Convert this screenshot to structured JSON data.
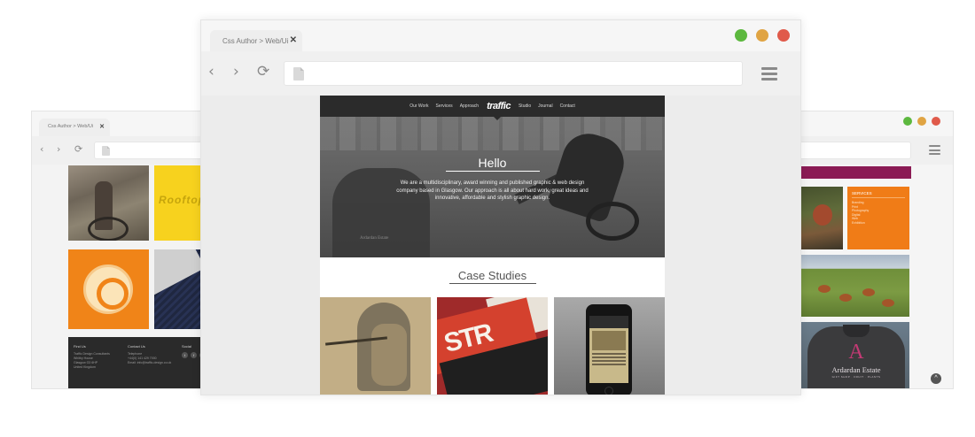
{
  "colors": {
    "dot_green": "#5cb83e",
    "dot_yellow": "#e0a443",
    "dot_red": "#e05a4a",
    "accent_orange": "#f08418",
    "accent_maroon": "#8b1b55"
  },
  "main_browser": {
    "tab_title": "Css Author > Web/Ui",
    "tab_close": "✕",
    "icons": {
      "back": "chevron-left-icon",
      "forward": "chevron-right-icon",
      "reload": "reload-icon",
      "page": "document-icon",
      "menu": "hamburger-menu-icon"
    },
    "glyphs": {
      "back": "‹",
      "forward": "›",
      "reload": "⟳"
    }
  },
  "left_browser": {
    "tab_title": "Css Author > Web/Ui",
    "tab_close": "✕",
    "glyphs": {
      "back": "‹",
      "forward": "›",
      "reload": "⟳"
    },
    "page": {
      "yellow_tile_text": "Rooftop",
      "footer": {
        "col1_heading": "Find Us",
        "col1_lines": [
          "Traffic Design Consultants",
          "Whitby House",
          "Glasgow G3 6HP",
          "United Kingdom"
        ],
        "col2_heading": "Contact Us",
        "col2_lines": [
          "Telephone",
          "+44(0) 141 429 7000",
          "Email: info@traffic-design.co.uk"
        ],
        "col3_heading": "Social",
        "social_icons": [
          "t",
          "f",
          "in"
        ]
      }
    }
  },
  "right_browser": {
    "page": {
      "services_title": "SERVICES",
      "services_items": [
        "Branding",
        "Print",
        "Photography",
        "Digital",
        "Web",
        "Exhibition"
      ],
      "jacket_initial": "A",
      "jacket_text": "Ardardan Estate",
      "jacket_subtext": "GIFT SHOP · FRUIT · PLANTS",
      "scroll_top": "^"
    }
  },
  "site": {
    "nav": {
      "items_left": [
        "Our Work",
        "Services",
        "Approach"
      ],
      "logo": "traffic",
      "items_right": [
        "Studio",
        "Journal",
        "Contact"
      ]
    },
    "hero": {
      "title": "Hello",
      "text": "We are a multidisciplinary, award winning and published graphic & web design company based in Glasgow. Our approach is all about hard work, great ideas and innovative, affordable and stylish graphic design.",
      "shirt_text": "Ardardan Estate"
    },
    "case_studies_title": "Case Studies",
    "case_tiles": [
      {
        "label": "flute-player-artwork"
      },
      {
        "label": "STR",
        "text": "STR"
      },
      {
        "label": "mobile-site-mockup"
      }
    ]
  }
}
